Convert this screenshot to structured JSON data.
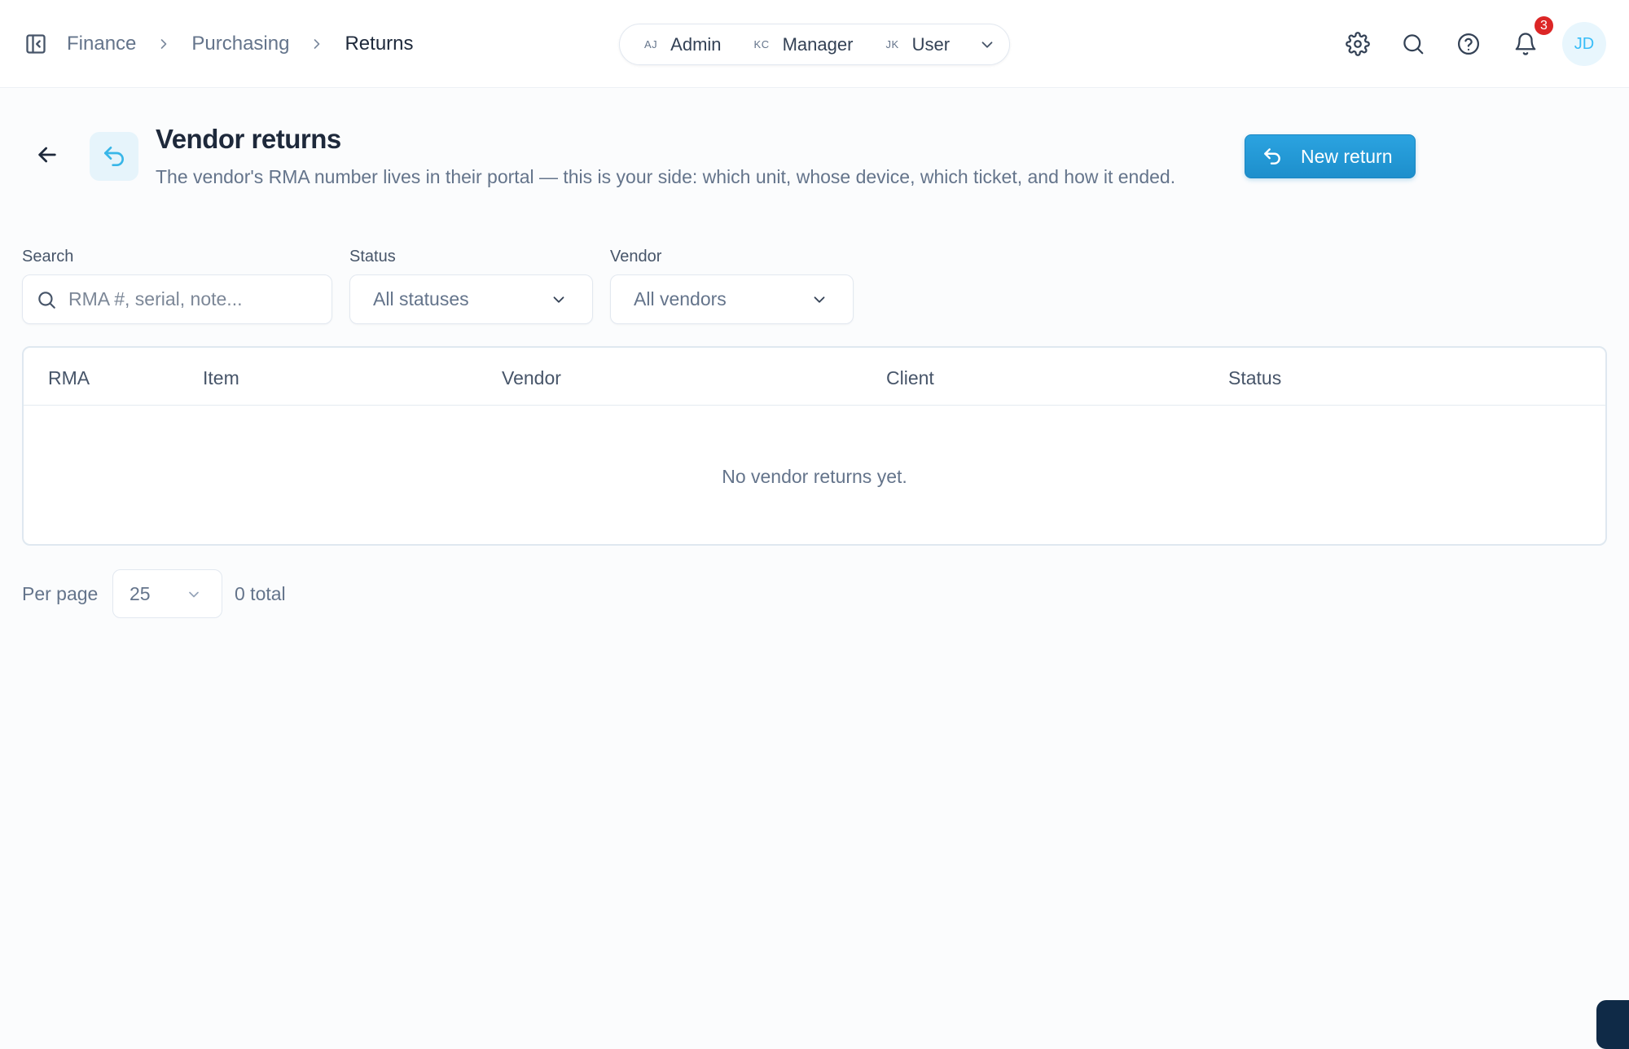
{
  "breadcrumb": {
    "items": [
      "Finance",
      "Purchasing",
      "Returns"
    ]
  },
  "role_switcher": {
    "roles": [
      {
        "initials": "AJ",
        "label": "Admin"
      },
      {
        "initials": "KC",
        "label": "Manager"
      },
      {
        "initials": "JK",
        "label": "User"
      }
    ]
  },
  "header_actions": {
    "notification_count": "3",
    "avatar_initials": "JD",
    "icons": [
      "gear-icon",
      "search-icon",
      "help-icon",
      "bell-icon"
    ]
  },
  "page": {
    "title": "Vendor returns",
    "subtitle": "The vendor's RMA number lives in their portal — this is your side: which unit, whose device, which ticket, and how it ended.",
    "new_button_label": "New return"
  },
  "filters": {
    "search_label": "Search",
    "search_placeholder": "RMA #, serial, note...",
    "status_label": "Status",
    "status_value": "All statuses",
    "vendor_label": "Vendor",
    "vendor_value": "All vendors"
  },
  "table": {
    "columns": [
      "RMA",
      "Item",
      "Vendor",
      "Client",
      "Status"
    ],
    "rows": [],
    "empty_message": "No vendor returns yet."
  },
  "pagination": {
    "per_page_label": "Per page",
    "per_page_value": "25",
    "total_text": "0 total"
  },
  "colors": {
    "accent": "#1d8fcc",
    "badge": "#dc2626",
    "avatar_bg": "#e8f6fd",
    "text_primary": "#1e293b",
    "text_muted": "#64748b"
  }
}
